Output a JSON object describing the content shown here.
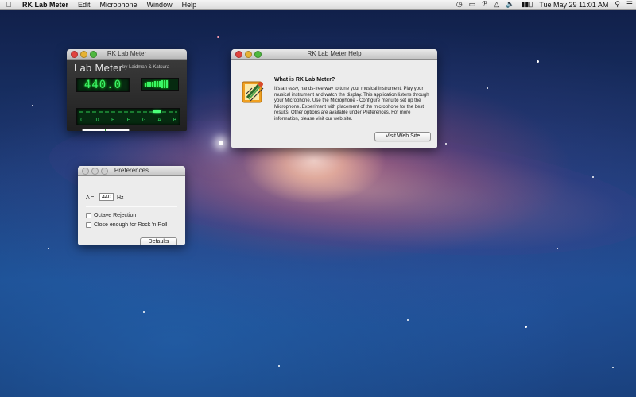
{
  "menubar": {
    "app_name": "RK Lab Meter",
    "menus": [
      "Edit",
      "Microphone",
      "Window",
      "Help"
    ],
    "status": {
      "datetime": "Tue May 29  11:01 AM"
    }
  },
  "lab_meter": {
    "window_title": "RK Lab Meter",
    "brand": "Lab Meter",
    "credit": "by Laidman & Katsura",
    "frequency_display": "440.0",
    "level_bars": 10,
    "note_labels": [
      "C",
      "D",
      "E",
      "F",
      "G",
      "A",
      "B"
    ],
    "colors": {
      "lcd_text": "#3cf56a",
      "lcd_bg": "#062a10"
    }
  },
  "help": {
    "window_title": "RK Lab Meter Help",
    "heading": "What is RK Lab Meter?",
    "body": "It's an easy, hands-free way to tune your musical instrument. Play your musical instrument and watch the display. This application listens through your Microphone. Use the Microphone - Configure menu to set up the Microphone. Experiment with placement of the microphone for the best results. Other options are available under Preferences. For more information, please visit our web site.",
    "button_label": "Visit Web Site",
    "icon": "tuning-fork-app-icon"
  },
  "preferences": {
    "window_title": "Preferences",
    "a_label": "A =",
    "a_value": "440",
    "unit": "Hz",
    "options": [
      {
        "label": "Octave Rejection",
        "checked": false
      },
      {
        "label": "Close enough for Rock 'n Roll",
        "checked": false
      }
    ],
    "defaults_label": "Defaults"
  }
}
